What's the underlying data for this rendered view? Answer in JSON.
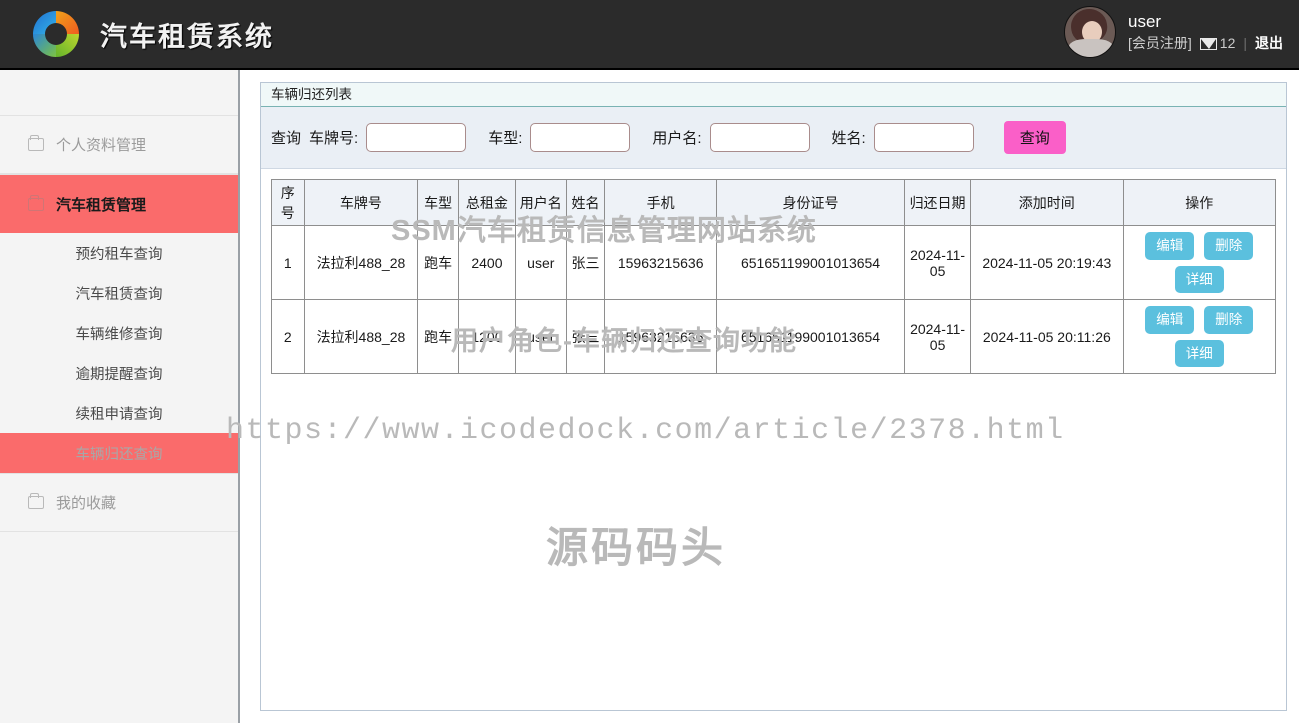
{
  "header": {
    "brand_title": "汽车租赁系统",
    "logo_icon": "color-ring-logo-icon",
    "user_name": "user",
    "register_link": "[会员注册]",
    "message_icon": "envelope-icon",
    "message_count": "12",
    "separator": "|",
    "logout_label": "退出"
  },
  "sidebar": {
    "groups": [
      {
        "label": "个人资料管理",
        "icon": "folder-icon",
        "active": false,
        "items": []
      },
      {
        "label": "汽车租赁管理",
        "icon": "folder-icon",
        "active": true,
        "items": [
          {
            "label": "预约租车查询",
            "selected": false
          },
          {
            "label": "汽车租赁查询",
            "selected": false
          },
          {
            "label": "车辆维修查询",
            "selected": false
          },
          {
            "label": "逾期提醒查询",
            "selected": false
          },
          {
            "label": "续租申请查询",
            "selected": false
          },
          {
            "label": "车辆归还查询",
            "selected": true
          }
        ]
      },
      {
        "label": "我的收藏",
        "icon": "folder-icon",
        "active": false,
        "items": []
      }
    ]
  },
  "panel": {
    "title": "车辆归还列表"
  },
  "filter": {
    "prefix": "查询",
    "fields": [
      {
        "label": "车牌号:",
        "value": "",
        "placeholder": ""
      },
      {
        "label": "车型:",
        "value": "",
        "placeholder": ""
      },
      {
        "label": "用户名:",
        "value": "",
        "placeholder": ""
      },
      {
        "label": "姓名:",
        "value": "",
        "placeholder": ""
      }
    ],
    "query_button": "查询"
  },
  "table": {
    "columns": [
      "序号",
      "车牌号",
      "车型",
      "总租金",
      "用户名",
      "姓名",
      "手机",
      "身份证号",
      "归还日期",
      "添加时间",
      "操作"
    ],
    "rows": [
      {
        "index": "1",
        "plate": "法拉利488_28",
        "car_type": "跑车",
        "total_fee": "2400",
        "username": "user",
        "name": "张三",
        "phone": "15963215636",
        "id_number": "651651199001013654",
        "return_date": "2024-11-05",
        "add_time": "2024-11-05 20:19:43",
        "ops": [
          "编辑",
          "删除",
          "详细"
        ]
      },
      {
        "index": "2",
        "plate": "法拉利488_28",
        "car_type": "跑车",
        "total_fee": "1200",
        "username": "user",
        "name": "张三",
        "phone": "15963215636",
        "id_number": "651651199001013654",
        "return_date": "2024-11-05",
        "add_time": "2024-11-05 20:11:26",
        "ops": [
          "编辑",
          "删除",
          "详细"
        ]
      }
    ]
  },
  "watermarks": {
    "line1": "SSM汽车租赁信息管理网站系统",
    "line2": "用户角色-车辆归还查询功能",
    "line3": "https://www.icodedock.com/article/2378.html",
    "line4": "源码码头"
  },
  "colors": {
    "topbar_bg": "#2b2b2b",
    "sidebar_active": "#fa6b6b",
    "query_button": "#fa5fc8",
    "op_button": "#5bc0de",
    "panel_border": "#b9c6d4",
    "watermark": "#b9b9b9"
  }
}
